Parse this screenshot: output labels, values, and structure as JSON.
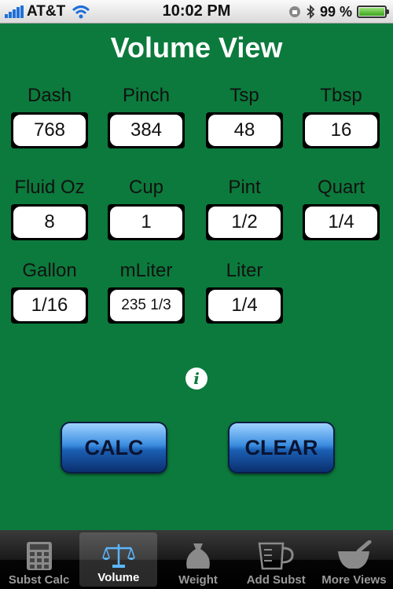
{
  "status_bar": {
    "carrier": "AT&T",
    "time": "10:02 PM",
    "battery_percent": "99 %",
    "battery_level": 0.99
  },
  "title": "Volume View",
  "units": [
    {
      "label": "Dash",
      "value": "768"
    },
    {
      "label": "Pinch",
      "value": "384"
    },
    {
      "label": "Tsp",
      "value": "48"
    },
    {
      "label": "Tbsp",
      "value": "16"
    },
    {
      "label": "Fluid Oz",
      "value": "8"
    },
    {
      "label": "Cup",
      "value": "1"
    },
    {
      "label": "Pint",
      "value": "1/2"
    },
    {
      "label": "Quart",
      "value": "1/4"
    },
    {
      "label": "Gallon",
      "value": "1/16"
    },
    {
      "label": "mLiter",
      "value": "235 1/3"
    },
    {
      "label": "Liter",
      "value": "1/4"
    }
  ],
  "buttons": {
    "calc": "CALC",
    "clear": "CLEAR"
  },
  "tabs": [
    {
      "label": "Subst Calc",
      "icon": "calculator-icon"
    },
    {
      "label": "Volume",
      "icon": "scales-icon",
      "selected": true
    },
    {
      "label": "Weight",
      "icon": "weight-bag-icon"
    },
    {
      "label": "Add Subst",
      "icon": "measuring-cup-icon"
    },
    {
      "label": "More Views",
      "icon": "mortar-pestle-icon"
    }
  ],
  "colors": {
    "background": "#0c7a3c",
    "button_blue": "#1b5fb3"
  }
}
